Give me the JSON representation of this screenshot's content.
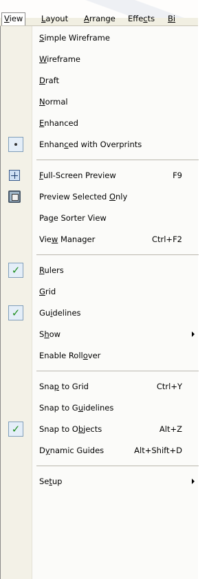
{
  "menubar": {
    "items": [
      {
        "pre": "",
        "u": "V",
        "post": "iew",
        "active": true
      },
      {
        "pre": "",
        "u": "L",
        "post": "ayout",
        "active": false
      },
      {
        "pre": "",
        "u": "A",
        "post": "rrange",
        "active": false
      },
      {
        "pre": "Effe",
        "u": "c",
        "post": "ts",
        "active": false
      },
      {
        "pre": "",
        "u": "Bi",
        "post": "",
        "active": false
      }
    ]
  },
  "menu": {
    "items": [
      {
        "pre": "",
        "u": "S",
        "post": "imple Wireframe",
        "shortcut": "",
        "mark": "",
        "arrow": false
      },
      {
        "pre": "",
        "u": "W",
        "post": "ireframe",
        "shortcut": "",
        "mark": "",
        "arrow": false
      },
      {
        "pre": "",
        "u": "D",
        "post": "raft",
        "shortcut": "",
        "mark": "",
        "arrow": false
      },
      {
        "pre": "",
        "u": "N",
        "post": "ormal",
        "shortcut": "",
        "mark": "",
        "arrow": false
      },
      {
        "pre": "",
        "u": "E",
        "post": "nhanced",
        "shortcut": "",
        "mark": "",
        "arrow": false
      },
      {
        "pre": "Enhan",
        "u": "c",
        "post": "ed with Overprints",
        "shortcut": "",
        "mark": "radio",
        "arrow": false
      },
      {
        "sep": true
      },
      {
        "pre": "",
        "u": "F",
        "post": "ull-Screen Preview",
        "shortcut": "F9",
        "mark": "fullscreen-icon",
        "arrow": false
      },
      {
        "pre": "Preview Selected ",
        "u": "O",
        "post": "nly",
        "shortcut": "",
        "mark": "preview-icon",
        "arrow": false
      },
      {
        "pre": "Pa",
        "u": "g",
        "post": "e Sorter View",
        "shortcut": "",
        "mark": "",
        "arrow": false
      },
      {
        "pre": "Vie",
        "u": "w",
        "post": " Manager",
        "shortcut": "Ctrl+F2",
        "mark": "",
        "arrow": false
      },
      {
        "sep": true
      },
      {
        "pre": "",
        "u": "R",
        "post": "ulers",
        "shortcut": "",
        "mark": "check",
        "arrow": false
      },
      {
        "pre": "",
        "u": "G",
        "post": "rid",
        "shortcut": "",
        "mark": "",
        "arrow": false
      },
      {
        "pre": "Gu",
        "u": "i",
        "post": "delines",
        "shortcut": "",
        "mark": "check",
        "arrow": false
      },
      {
        "pre": "S",
        "u": "h",
        "post": "ow",
        "shortcut": "",
        "mark": "",
        "arrow": true
      },
      {
        "pre": "Enable Roll",
        "u": "o",
        "post": "ver",
        "shortcut": "",
        "mark": "",
        "arrow": false
      },
      {
        "sep": true
      },
      {
        "pre": "Sna",
        "u": "p",
        "post": " to Grid",
        "shortcut": "Ctrl+Y",
        "mark": "",
        "arrow": false
      },
      {
        "pre": "Snap to G",
        "u": "u",
        "post": "idelines",
        "shortcut": "",
        "mark": "",
        "arrow": false
      },
      {
        "pre": "Snap to O",
        "u": "b",
        "post": "jects",
        "shortcut": "Alt+Z",
        "mark": "check",
        "arrow": false
      },
      {
        "pre": "D",
        "u": "y",
        "post": "namic Guides",
        "shortcut": "Alt+Shift+D",
        "mark": "",
        "arrow": false
      },
      {
        "sep": true
      },
      {
        "pre": "Se",
        "u": "t",
        "post": "up",
        "shortcut": "",
        "mark": "",
        "arrow": true
      }
    ]
  }
}
